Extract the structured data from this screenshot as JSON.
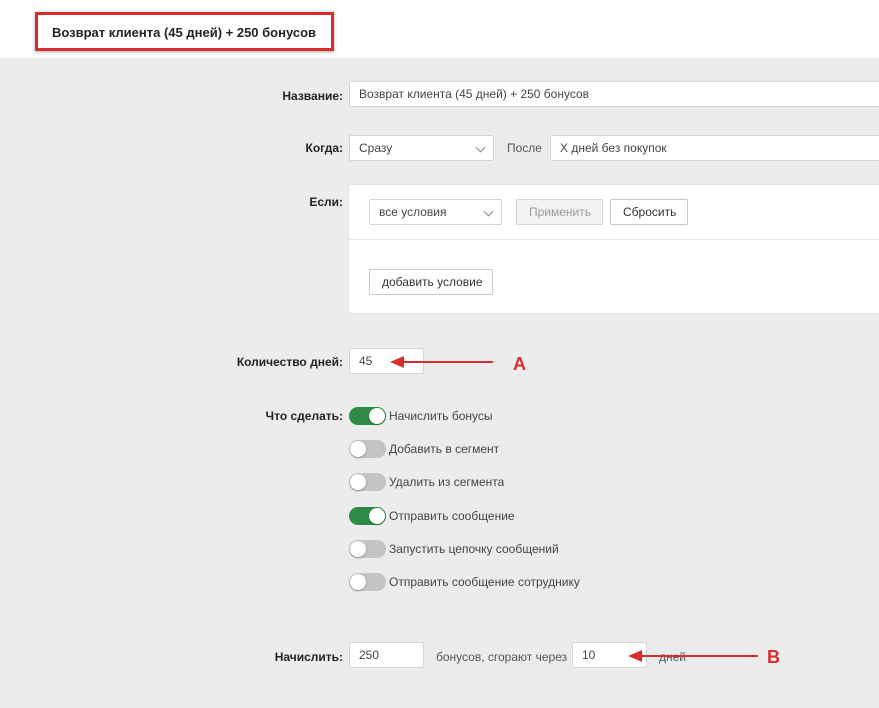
{
  "header": {
    "title": "Возврат клиента (45 дней) + 250 бонусов"
  },
  "form": {
    "name": {
      "label": "Название:",
      "value": "Возврат клиента (45 дней) + 250 бонусов"
    },
    "when": {
      "label": "Когда:",
      "select_value": "Сразу",
      "after_label": "После",
      "after_value": "X дней без покупок"
    },
    "if": {
      "label": "Если:",
      "conditions_select": "все условия",
      "apply_button": "Применить",
      "reset_button": "Сбросить",
      "add_condition_button": "добавить условие"
    },
    "days": {
      "label": "Количество дней:",
      "value": "45"
    },
    "actions": {
      "label": "Что сделать:",
      "items": [
        {
          "label": "Начислить бонусы",
          "enabled": true
        },
        {
          "label": "Добавить в сегмент",
          "enabled": false
        },
        {
          "label": "Удалить из сегмента",
          "enabled": false
        },
        {
          "label": "Отправить сообщение",
          "enabled": true
        },
        {
          "label": "Запустить цепочку сообщений",
          "enabled": false
        },
        {
          "label": "Отправить сообщение сотруднику",
          "enabled": false
        }
      ]
    },
    "accrue": {
      "label": "Начислить:",
      "bonus_value": "250",
      "middle_text": "бонусов, сгорают через",
      "expire_value": "10",
      "suffix": "дней"
    }
  },
  "annotations": {
    "marker_a": "A",
    "marker_b": "B",
    "color": "#d62e2e"
  },
  "colors": {
    "toggle_on": "#2e8b47",
    "toggle_off": "#c4c4c4",
    "highlight_border": "#d62e2e"
  }
}
